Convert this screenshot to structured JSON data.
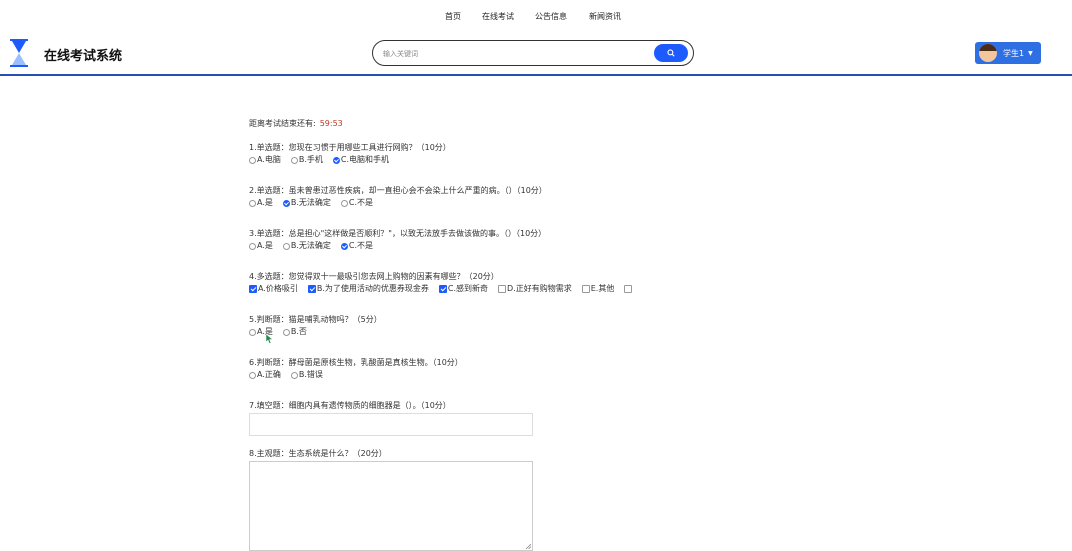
{
  "nav": {
    "items": [
      "首页",
      "在线考试",
      "公告信息",
      "新闻资讯"
    ]
  },
  "header": {
    "brand": "在线考试系统",
    "search_placeholder": "输入关键词",
    "user_name": "学生1"
  },
  "exam": {
    "timer_label": "距离考试结束还有:",
    "timer_value": "59:53",
    "questions": [
      {
        "title": "1.单选题：您现在习惯于用哪些工具进行网购？（10分）",
        "options": [
          "A.电脑",
          "B.手机",
          "C.电脑和手机"
        ]
      },
      {
        "title": "2.单选题：虽未曾患过恶性疾病，却一直担心会不会染上什么严重的病。（）（10分）",
        "options": [
          "A.是",
          "B.无法确定",
          "C.不是"
        ]
      },
      {
        "title": "3.单选题：总是担心\"这样做是否顺利？\"，以致无法放手去做该做的事。（）（10分）",
        "options": [
          "A.是",
          "B.无法确定",
          "C.不是"
        ]
      },
      {
        "title": "4.多选题：您觉得双十一最吸引您去网上购物的因素有哪些？（20分）",
        "options": [
          "A.价格吸引",
          "B.为了使用活动的优惠券现金券",
          "C.感到新奇",
          "D.正好有购物需求",
          "E.其他"
        ]
      },
      {
        "title": "5.判断题：猫是哺乳动物吗？（5分）",
        "options": [
          "A.是",
          "B.否"
        ]
      },
      {
        "title": "6.判断题：酵母菌是原核生物，乳酸菌是真核生物。（10分）",
        "options": [
          "A.正确",
          "B.错误"
        ]
      },
      {
        "title": "7.填空题：细胞内具有遗传物质的细胞器是（）。（10分）"
      },
      {
        "title": "8.主观题：生态系统是什么？（20分）"
      }
    ],
    "selected": {
      "q1": "C.电脑和手机",
      "q2": "B.无法确定",
      "q3": "C.不是",
      "q4": [
        "A.价格吸引",
        "B.为了使用活动的优惠券现金券",
        "C.感到新奇"
      ]
    }
  },
  "colors": {
    "accent": "#1e5bff",
    "header_border": "#2551b5",
    "timer": "#c0392b"
  }
}
